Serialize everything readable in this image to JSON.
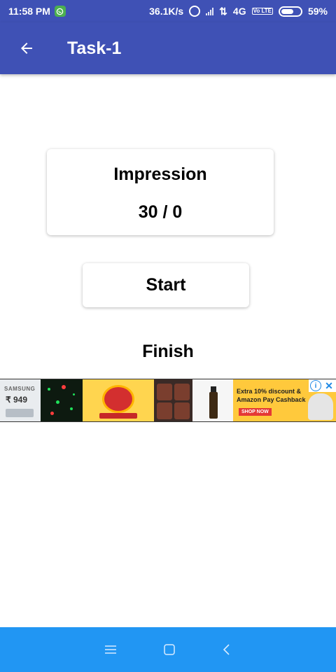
{
  "status_bar": {
    "time": "11:58 PM",
    "speed": "36.1K/s",
    "network": "4G",
    "volte": "Vo LTE",
    "battery": "59%"
  },
  "app_bar": {
    "title": "Task-1"
  },
  "impression": {
    "label": "Impression",
    "value": "30 / 0"
  },
  "start_button_label": "Start",
  "finish_label": "Finish",
  "ad": {
    "samsung_brand": "SAMSUNG",
    "samsung_price": "₹ 949",
    "promo_line_1": "Extra 10% discount &",
    "promo_line_2": "Amazon Pay Cashback",
    "shop_now": "SHOP NOW",
    "info_glyph": "i",
    "close_glyph": "✕"
  },
  "colors": {
    "primary": "#3f51b5",
    "nav_bar": "#2196f3"
  }
}
